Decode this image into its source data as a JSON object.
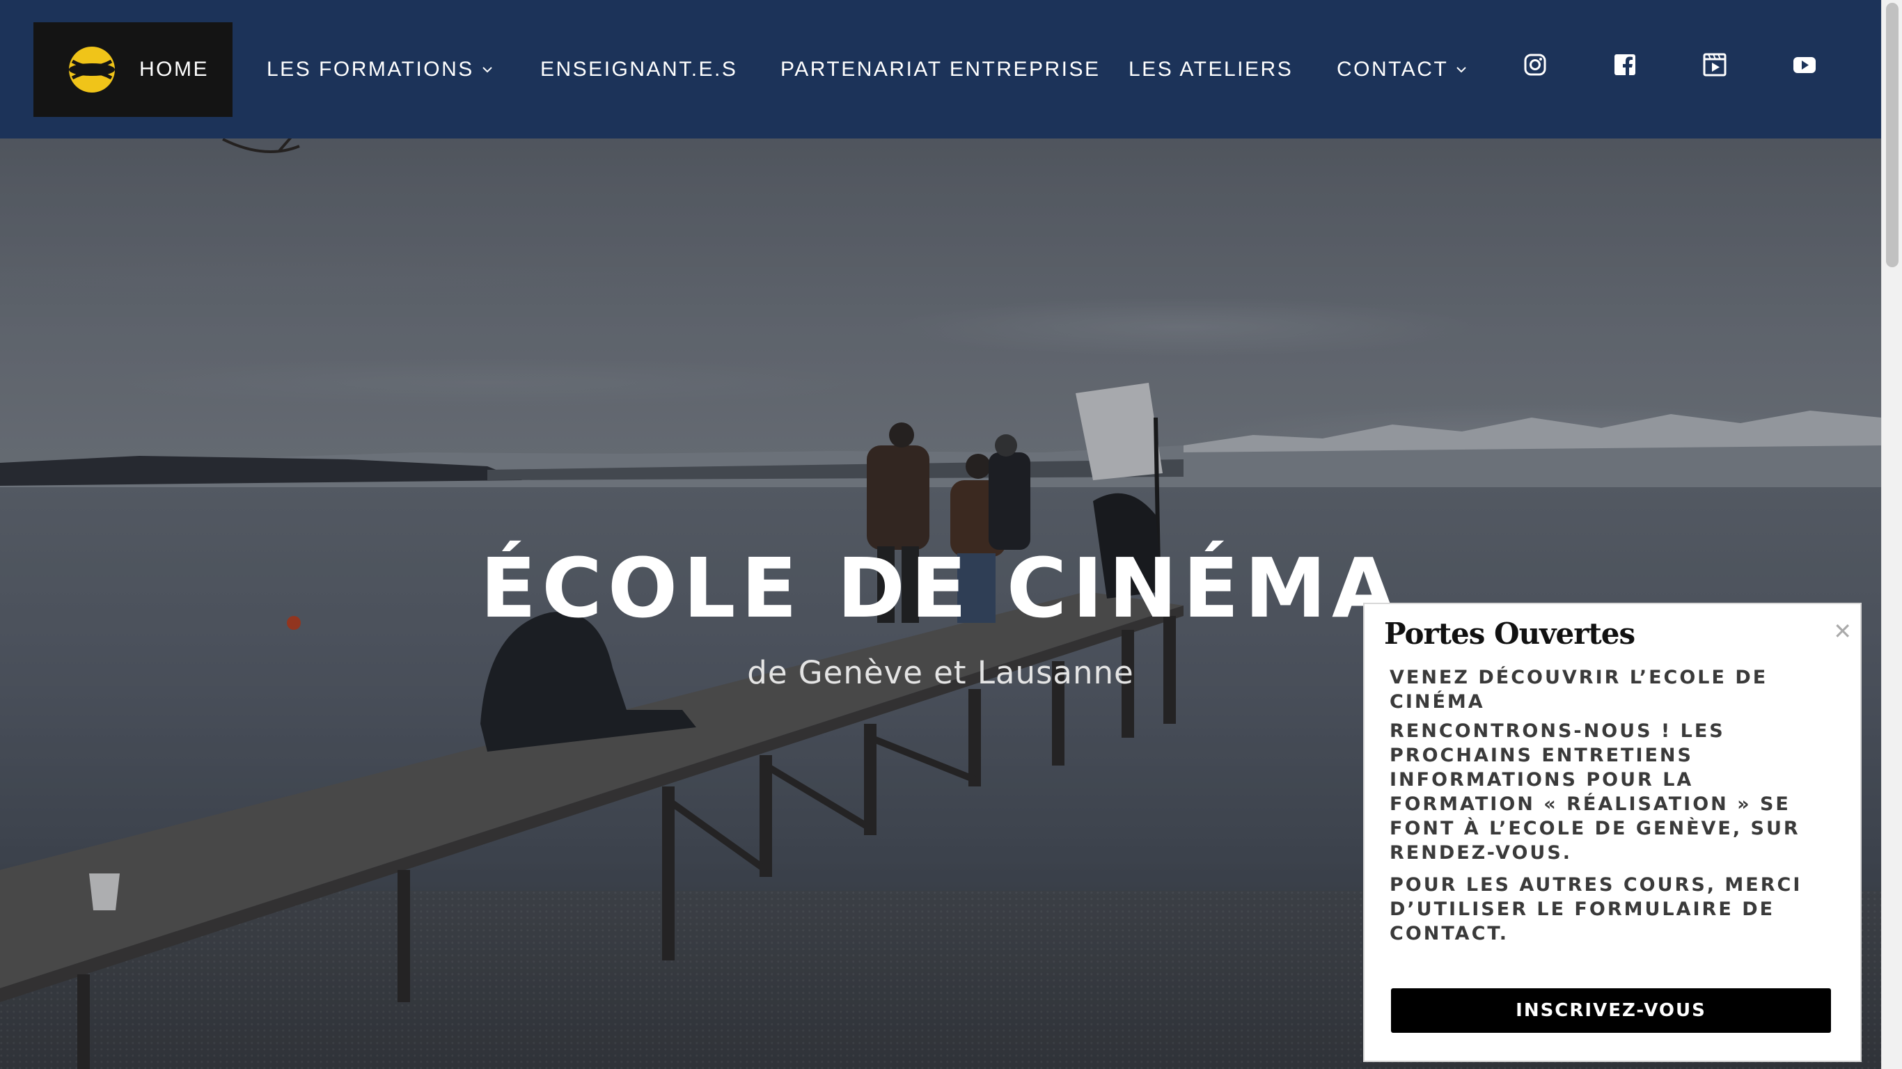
{
  "header": {
    "logo_icon": "yellow-circle-logo",
    "nav": [
      {
        "label": "HOME",
        "active": true
      },
      {
        "label": "LES FORMATIONS",
        "has_dropdown": true
      },
      {
        "label": "ENSEIGNANT.E.S"
      },
      {
        "label": "PARTENARIAT ENTREPRISE"
      },
      {
        "label": "LES ATELIERS"
      },
      {
        "label": "CONTACT",
        "has_dropdown": true
      }
    ],
    "social_icons": [
      "instagram-icon",
      "facebook-icon",
      "vimeo-play-icon",
      "youtube-icon"
    ],
    "background_color": "#1c3359"
  },
  "hero": {
    "title": "ÉCOLE DE CINÉMA",
    "subtitle": "de Genève et Lausanne"
  },
  "popup": {
    "title": "Portes Ouvertes",
    "close_icon": "close-icon",
    "paragraphs": [
      "Venez découvrir l’Ecole de Cinéma",
      "Rencontrons-nous ! Les prochains entretiens informations pour la formation « Réalisation » se font à l’Ecole de Genève, sur rendez-vous.",
      "Pour les autres cours, merci d’utiliser le formulaire de contact."
    ],
    "button_label": "INSCRIVEZ-VOUS"
  }
}
